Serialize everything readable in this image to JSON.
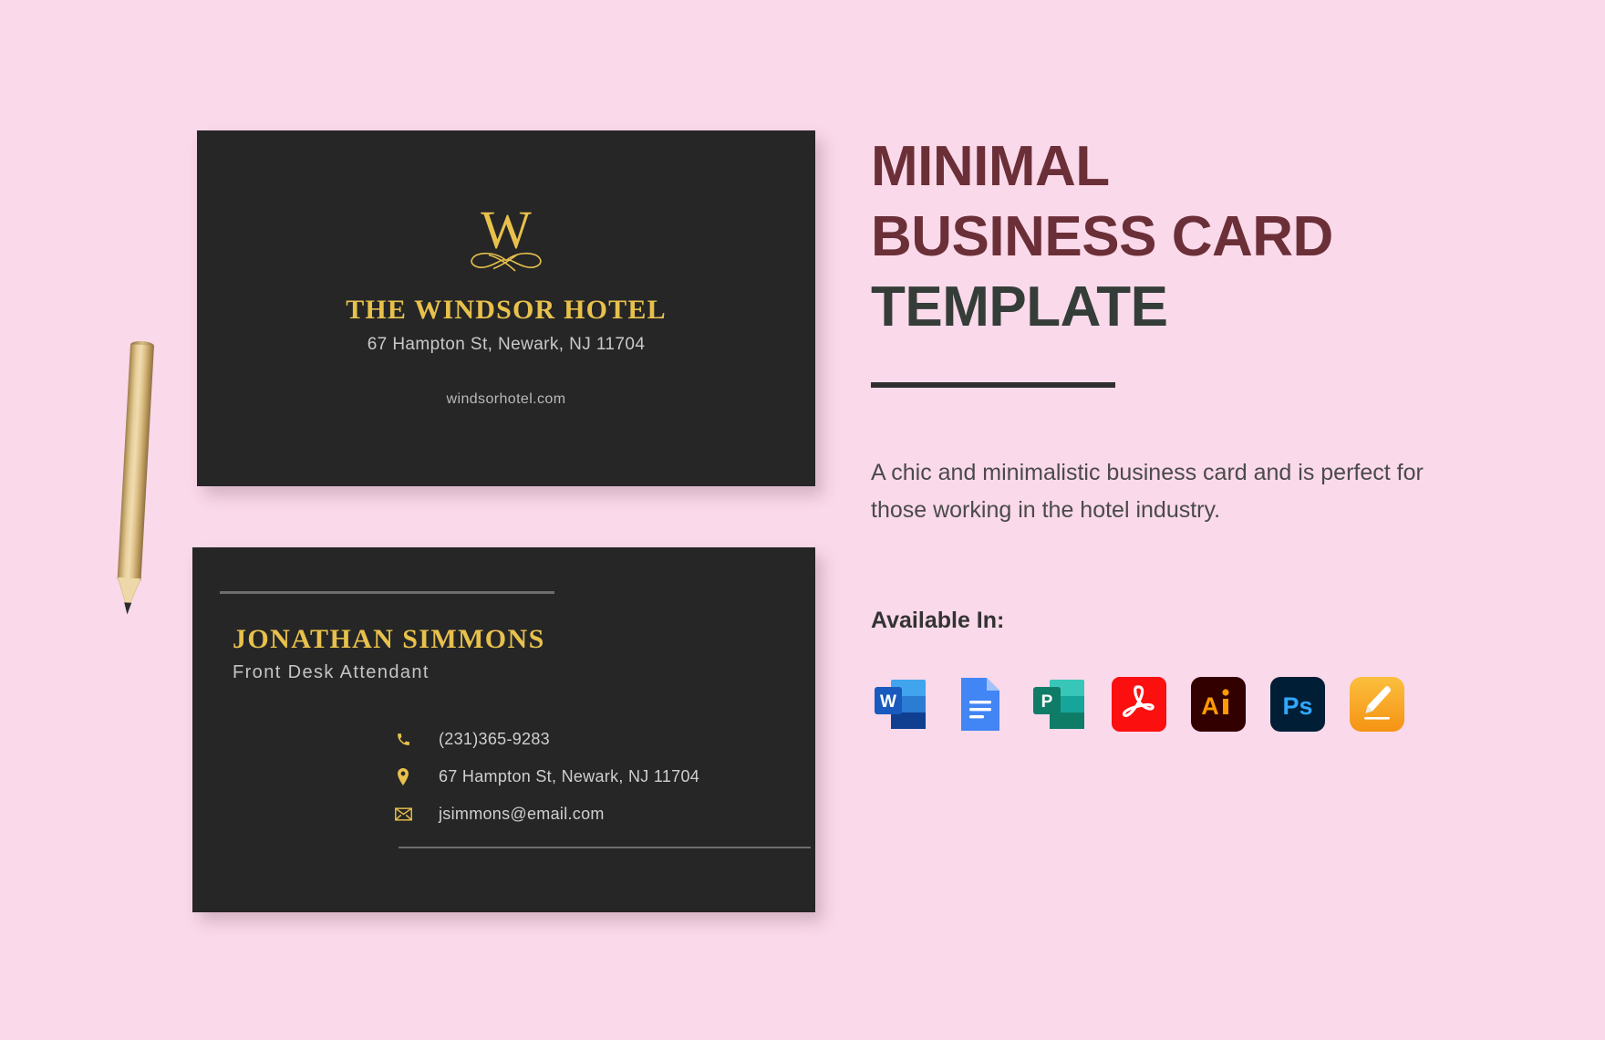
{
  "page": {
    "background_color": "#FAD9EA",
    "card_color": "#262626",
    "gold_color": "#E8C14C",
    "title_maroon": "#6B2F38",
    "title_dark": "#353D38"
  },
  "card_front": {
    "logo_icon": "windsor-w-monogram-icon",
    "logo_letter": "W",
    "hotel_name": "THE WINDSOR HOTEL",
    "address": "67 Hampton St, Newark, NJ 11704",
    "website": "windsorhotel.com"
  },
  "card_back": {
    "person_name": "JONATHAN SIMMONS",
    "person_role": "Front Desk Attendant",
    "contacts": [
      {
        "icon": "phone-icon",
        "text": "(231)365-9283"
      },
      {
        "icon": "location-pin-icon",
        "text": "67 Hampton St, Newark, NJ 11704"
      },
      {
        "icon": "envelope-icon",
        "text": "jsimmons@email.com"
      }
    ]
  },
  "right_panel": {
    "title_line1": "MINIMAL",
    "title_line2": "BUSINESS CARD",
    "title_line3": "TEMPLATE",
    "description": "A chic and minimalistic business card and is perfect for those working in the hotel industry.",
    "available_label": "Available In:",
    "formats": [
      {
        "name": "microsoft-word-icon",
        "label": "W",
        "color": "#2B5797"
      },
      {
        "name": "google-docs-icon",
        "label": "",
        "color": "#4285F4"
      },
      {
        "name": "microsoft-publisher-icon",
        "label": "P",
        "color": "#0F7C68"
      },
      {
        "name": "adobe-pdf-icon",
        "label": "",
        "color": "#FB0F0F"
      },
      {
        "name": "adobe-illustrator-icon",
        "label": "Ai",
        "color": "#330000"
      },
      {
        "name": "adobe-photoshop-icon",
        "label": "Ps",
        "color": "#001E36"
      },
      {
        "name": "apple-pages-icon",
        "label": "",
        "color": "#F5A623"
      }
    ]
  },
  "decor": {
    "pencil": "wooden-pencil"
  }
}
